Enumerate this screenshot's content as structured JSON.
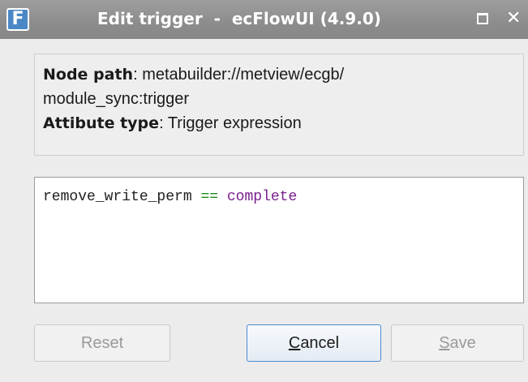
{
  "window": {
    "icon_letter": "F",
    "title": "Edit trigger  -  ecFlowUI (4.9.0)",
    "maximize_icon": "maximize-icon",
    "close_symbol": "✕"
  },
  "info": {
    "node_path_label": "Node path",
    "node_path_value_line1": "metabuilder://metview/ecgb/",
    "node_path_value_line2": "module_sync:trigger",
    "attribute_type_label": "Attibute type",
    "attribute_type_value": "Trigger expression"
  },
  "editor": {
    "lhs": "remove_write_perm",
    "operator": "==",
    "rhs": "complete",
    "colors": {
      "operator": "#1a8f1a",
      "keyword": "#7b1f8f"
    }
  },
  "buttons": {
    "reset_label": "Reset",
    "cancel_mnemonic": "C",
    "cancel_rest": "ancel",
    "save_mnemonic": "S",
    "save_rest": "ave"
  }
}
